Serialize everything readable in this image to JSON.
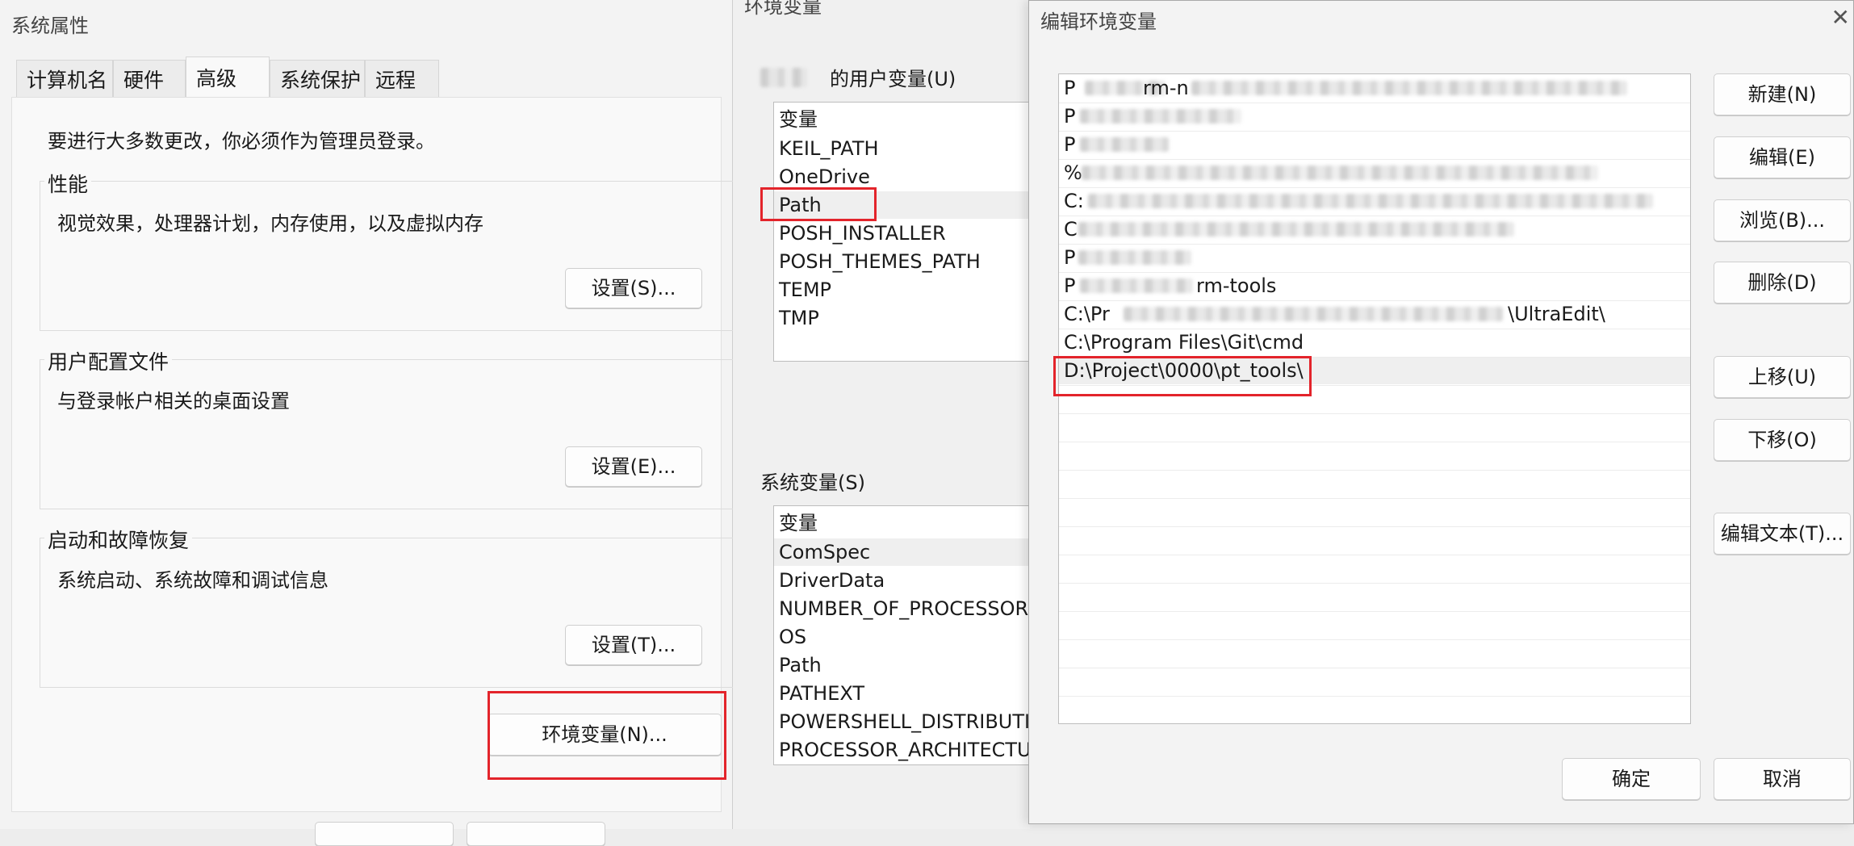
{
  "sys_props": {
    "title": "系统属性",
    "tabs": [
      "计算机名",
      "硬件",
      "高级",
      "系统保护",
      "远程"
    ],
    "admin_note": "要进行大多数更改，你必须作为管理员登录。",
    "perf_title": "性能",
    "perf_desc": "视觉效果，处理器计划，内存使用，以及虚拟内存",
    "perf_btn": "设置(S)...",
    "profile_title": "用户配置文件",
    "profile_desc": "与登录帐户相关的桌面设置",
    "profile_btn": "设置(E)...",
    "startup_title": "启动和故障恢复",
    "startup_desc": "系统启动、系统故障和调试信息",
    "startup_btn": "设置(T)...",
    "env_btn": "环境变量(N)..."
  },
  "env_vars": {
    "title": "环境变量",
    "user_label": "的用户变量(U)",
    "user_header": "变量",
    "user_vars": [
      "KEIL_PATH",
      "OneDrive",
      "Path",
      "POSH_INSTALLER",
      "POSH_THEMES_PATH",
      "TEMP",
      "TMP"
    ],
    "sys_label": "系统变量(S)",
    "sys_header": "变量",
    "sys_vars": [
      "ComSpec",
      "DriverData",
      "NUMBER_OF_PROCESSORS",
      "OS",
      "Path",
      "PATHEXT",
      "POWERSHELL_DISTRIBUTI...",
      "PROCESSOR_ARCHITECTU..."
    ]
  },
  "edit_env": {
    "title": "编辑环境变量",
    "entries": [
      {
        "text": "P",
        "tail": "rm-n"
      },
      {
        "text": "P",
        "tail": ""
      },
      {
        "text": "P",
        "tail": ""
      },
      {
        "text": "%",
        "tail": ""
      },
      {
        "text": "C:",
        "tail": ""
      },
      {
        "text": "C",
        "tail": ""
      },
      {
        "text": "P",
        "tail": ""
      },
      {
        "text": "P",
        "tail": "rm-tools"
      },
      {
        "text": "C:\\Pr",
        "tail": "\\UltraEdit\\"
      },
      {
        "text": "C:\\Program Files\\Git\\cmd",
        "tail": ""
      },
      {
        "text": "D:\\Project\\0000\\pt_tools\\",
        "tail": ""
      }
    ],
    "buttons": {
      "new": "新建(N)",
      "edit": "编辑(E)",
      "browse": "浏览(B)...",
      "delete": "删除(D)",
      "up": "上移(U)",
      "down": "下移(O)",
      "edit_text": "编辑文本(T)..."
    },
    "ok": "确定",
    "cancel": "取消"
  }
}
